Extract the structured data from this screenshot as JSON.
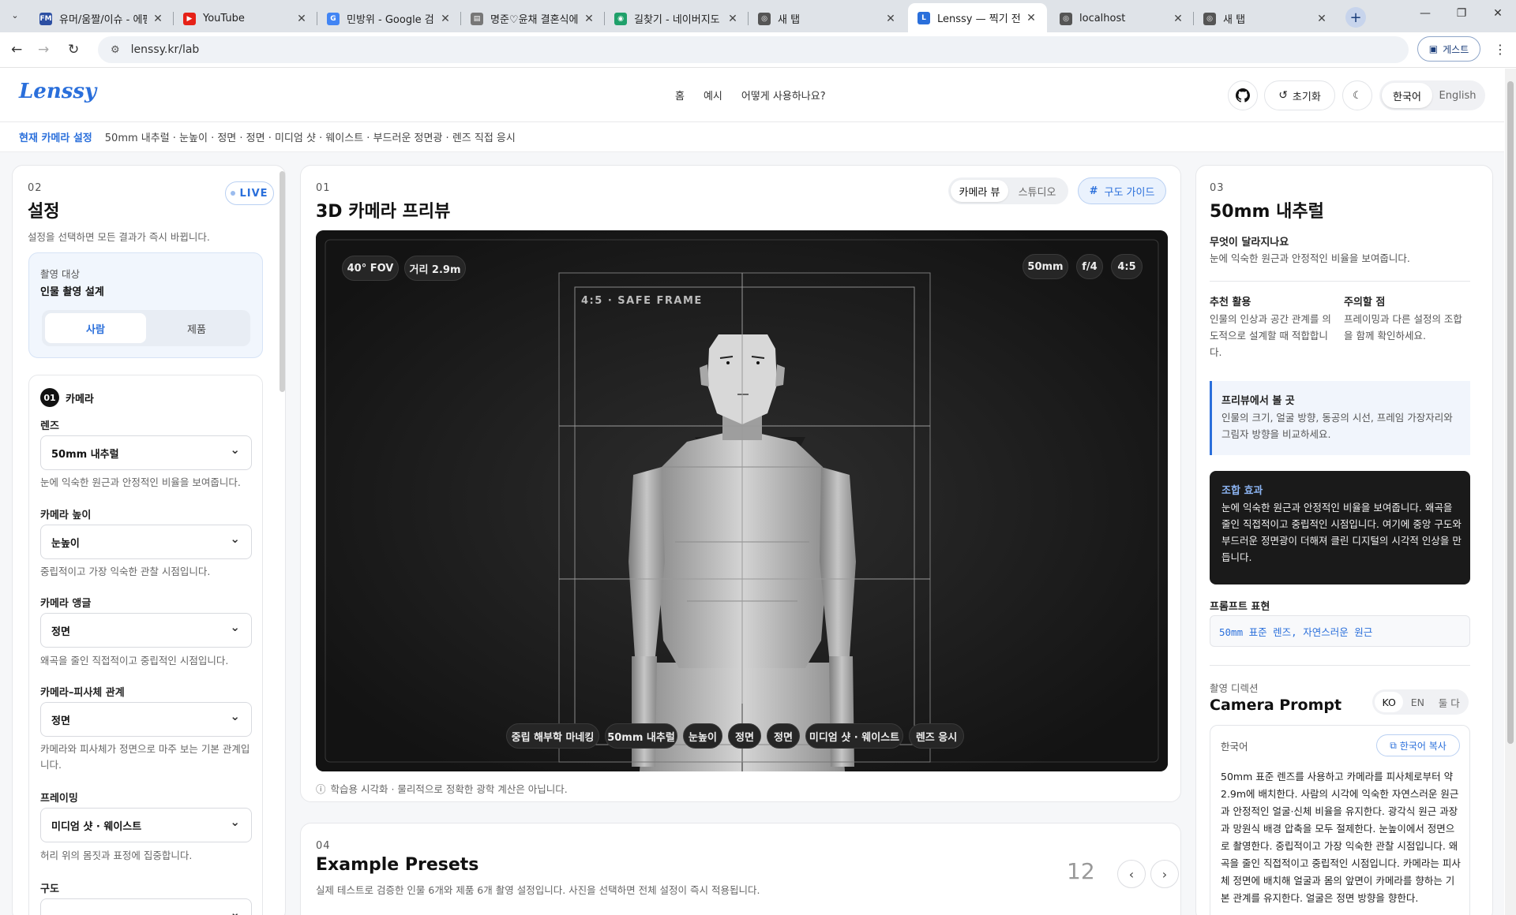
{
  "browser": {
    "tabs": [
      {
        "title": "유머/움짤/이슈 - 에펨",
        "icon": "FM",
        "color": "#2c4fa3"
      },
      {
        "title": "YouTube",
        "icon": "▶",
        "color": "#e62117"
      },
      {
        "title": "민방위 - Google 검색",
        "icon": "G",
        "color": "#4285f4"
      },
      {
        "title": "명준♡윤채 결혼식에",
        "icon": "▤",
        "color": "#777777"
      },
      {
        "title": "길찾기 - 네이버지도",
        "icon": "◉",
        "color": "#1fa06a"
      },
      {
        "title": "새 탭",
        "icon": "◎",
        "color": "#555555"
      },
      {
        "title": "Lenssy — 찍기 전에,",
        "icon": "L",
        "color": "#2a6fdb"
      },
      {
        "title": "localhost",
        "icon": "◎",
        "color": "#555555"
      },
      {
        "title": "새 탭",
        "icon": "◎",
        "color": "#555555"
      }
    ],
    "url": "lenssy.kr/lab",
    "guest_label": "게스트"
  },
  "header": {
    "logo": "Lenssy",
    "nav": [
      "홈",
      "예시",
      "어떻게 사용하나요?"
    ],
    "reset_label": "초기화",
    "lang": [
      "한국어",
      "English"
    ]
  },
  "current_settings": {
    "label": "현재 카메라 설정",
    "value": "50mm 내추럴 · 눈높이 · 정면 · 정면 · 미디엄 샷 · 웨이스트 · 부드러운 정면광 · 렌즈 직접 응시"
  },
  "settings_panel": {
    "number": "02",
    "title": "설정",
    "live": "LIVE",
    "subtitle": "설정을 선택하면 모든 결과가 즉시 바뀝니다.",
    "target_label": "촬영 대상",
    "target_value": "인물 촬영 설계",
    "target_options": [
      "사람",
      "제품"
    ],
    "group_number": "01",
    "group_title": "카메라",
    "fields": [
      {
        "label": "렌즈",
        "value": "50mm 내추럴",
        "desc": "눈에 익숙한 원근과 안정적인 비율을 보여줍니다."
      },
      {
        "label": "카메라 높이",
        "value": "눈높이",
        "desc": "중립적이고 가장 익숙한 관찰 시점입니다."
      },
      {
        "label": "카메라 앵글",
        "value": "정면",
        "desc": "왜곡을 줄인 직접적이고 중립적인 시점입니다."
      },
      {
        "label": "카메라–피사체 관계",
        "value": "정면",
        "desc": "카메라와 피사체가 정면으로 마주 보는 기본 관계입니다."
      },
      {
        "label": "프레이밍",
        "value": "미디엄 샷 · 웨이스트",
        "desc": "허리 위의 몸짓과 표정에 집중합니다."
      },
      {
        "label": "구도",
        "value": "",
        "desc": ""
      }
    ]
  },
  "preview": {
    "number": "01",
    "title": "3D 카메라 프리뷰",
    "view_modes": [
      "카메라 뷰",
      "스튜디오"
    ],
    "guide_label": "구도 가이드",
    "top_left_chips": [
      "40° FOV",
      "거리 2.9m"
    ],
    "top_right_chips": [
      "50mm",
      "f/4",
      "4:5"
    ],
    "safe_frame_label": "4:5 · SAFE FRAME",
    "bottom_chips": [
      "중립 해부학 마네킹",
      "50mm 내추럴",
      "눈높이",
      "정면",
      "정면",
      "미디엄 샷 · 웨이스트",
      "렌즈 응시"
    ],
    "note": "학습용 시각화 · 물리적으로 정확한 광학 계산은 아닙니다."
  },
  "presets": {
    "number": "04",
    "title": "Example Presets",
    "subtitle": "실제 테스트로 검증한 인물 6개와 제품 6개 촬영 설정입니다. 사진을 선택하면 전체 설정이 즉시 적용됩니다.",
    "count": "12"
  },
  "lens_info": {
    "number": "03",
    "title": "50mm 내추럴",
    "what_changes_label": "무엇이 달라지나요",
    "what_changes": "눈에 익숙한 원근과 안정적인 비율을 보여줍니다.",
    "recommend_label": "추천 활용",
    "recommend": "인물의 인상과 공간 관계를 의도적으로 설계할 때 적합합니다.",
    "caution_label": "주의할 점",
    "caution": "프레이밍과 다른 설정의 조합을 함께 확인하세요.",
    "preview_look_label": "프리뷰에서 볼 곳",
    "preview_look": "인물의 크기, 얼굴 방향, 동공의 시선, 프레임 가장자리와 그림자 방향을 비교하세요.",
    "combo_label": "조합 효과",
    "combo": "눈에 익숙한 원근과 안정적인 비율을 보여줍니다. 왜곡을 줄인 직접적이고 중립적인 시점입니다. 여기에 중앙 구도와 부드러운 정면광이 더해져 클린 디지털의 시각적 인상을 만듭니다.",
    "prompt_expr_label": "프롬프트 표현",
    "prompt_expr": "50mm 표준 렌즈, 자연스러운 원근",
    "direction_label": "촬영 디렉션",
    "camera_prompt_title": "Camera Prompt",
    "prompt_langs": [
      "KO",
      "EN",
      "둘 다"
    ],
    "korean_label": "한국어",
    "copy_label": "한국어 복사",
    "korean_prompt": "50mm 표준 렌즈를 사용하고 카메라를 피사체로부터 약 2.9m에 배치한다. 사람의 시각에 익숙한 자연스러운 원근과 안정적인 얼굴·신체 비율을 유지한다. 광각식 원근 과장과 망원식 배경 압축을 모두 절제한다. 눈높이에서 정면으로 촬영한다. 중립적이고 가장 익숙한 관찰 시점입니다. 왜곡을 줄인 직접적이고 중립적인 시점입니다. 카메라는 피사체 정면에 배치해 얼굴과 몸의 앞면이 카메라를 향하는 기본 관계를 유지한다. 얼굴은 정면 방향을 향한다."
  }
}
